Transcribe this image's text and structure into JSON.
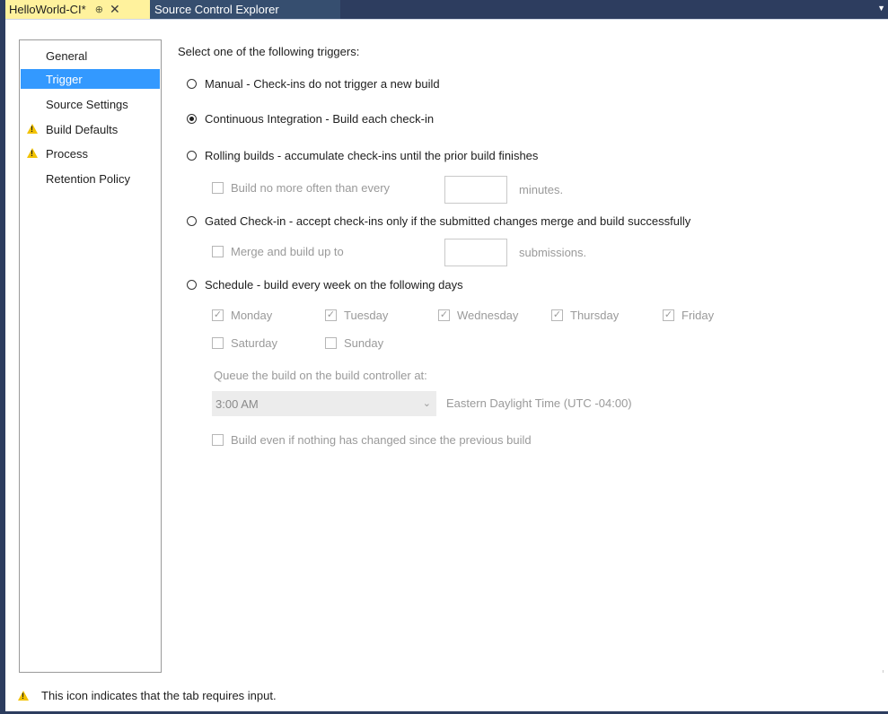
{
  "tabs": {
    "active": {
      "label": "HelloWorld-CI*",
      "pin_glyph": "⊕",
      "close_glyph": "✕"
    },
    "inactive": {
      "label": "Source Control Explorer"
    },
    "menu_glyph": "▼"
  },
  "sidebar": {
    "items": [
      {
        "label": "General",
        "warning": false,
        "selected": false
      },
      {
        "label": "Trigger",
        "warning": false,
        "selected": true
      },
      {
        "label": "Source Settings",
        "warning": false,
        "selected": false
      },
      {
        "label": "Build Defaults",
        "warning": true,
        "selected": false
      },
      {
        "label": "Process",
        "warning": true,
        "selected": false
      },
      {
        "label": "Retention Policy",
        "warning": false,
        "selected": false
      }
    ]
  },
  "trigger": {
    "heading": "Select one of the following triggers:",
    "options": [
      {
        "label": "Manual - Check-ins do not trigger a new build",
        "selected": false
      },
      {
        "label": "Continuous Integration - Build each check-in",
        "selected": true
      },
      {
        "label": "Rolling builds - accumulate check-ins until the prior build finishes",
        "selected": false
      },
      {
        "label": "Gated Check-in - accept check-ins only if the submitted changes merge and build successfully",
        "selected": false
      },
      {
        "label": "Schedule - build every week on the following days",
        "selected": false
      }
    ],
    "rolling": {
      "checkbox_label": "Build no more often than every",
      "value": "",
      "unit": "minutes."
    },
    "gated": {
      "checkbox_label": "Merge and build up to",
      "value": "",
      "unit": "submissions."
    },
    "schedule": {
      "days": [
        {
          "label": "Monday",
          "checked": true
        },
        {
          "label": "Tuesday",
          "checked": true
        },
        {
          "label": "Wednesday",
          "checked": true
        },
        {
          "label": "Thursday",
          "checked": true
        },
        {
          "label": "Friday",
          "checked": true
        },
        {
          "label": "Saturday",
          "checked": false
        },
        {
          "label": "Sunday",
          "checked": false
        }
      ],
      "queue_label": "Queue the build on the build controller at:",
      "time": "3:00 AM",
      "timezone": "Eastern Daylight Time (UTC -04:00)",
      "force_build_label": "Build even if nothing has changed since the previous build"
    }
  },
  "footer": {
    "text": "This icon indicates that the tab requires input."
  },
  "icons": {
    "warning": "warning-icon",
    "check": "✓",
    "dropdown": "chevron-down-icon"
  },
  "colors": {
    "active_tab": "#fff29d",
    "tab_bar": "#2d3d5f",
    "selection": "#3399ff",
    "warning": "#f2c200",
    "disabled_text": "#9a9a9a"
  }
}
